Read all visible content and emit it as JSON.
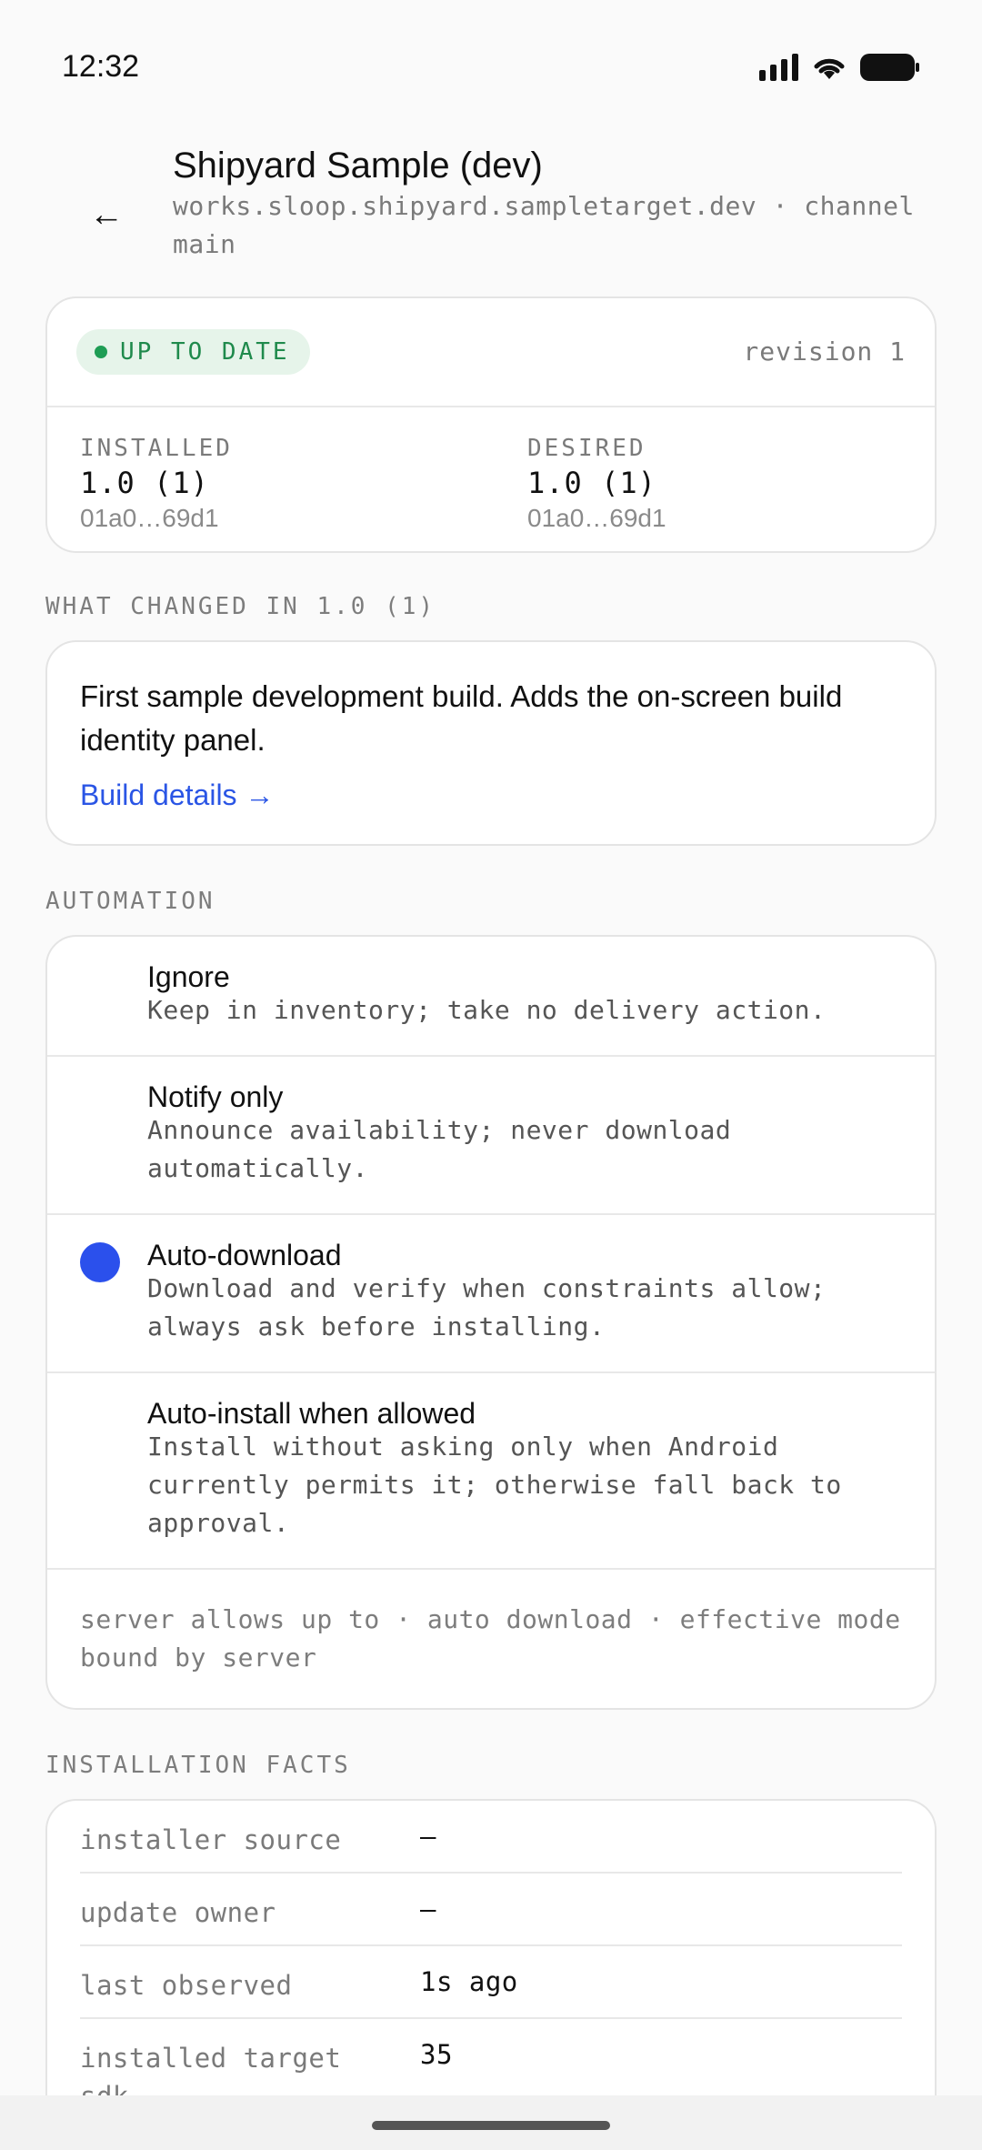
{
  "status_bar": {
    "time": "12:32",
    "icons": [
      "signal-icon",
      "wifi-icon",
      "battery-icon"
    ]
  },
  "header": {
    "back_icon": "←",
    "title": "Shipyard Sample (dev)",
    "subtitle": "works.sloop.shipyard.sampletarget.dev · channel main"
  },
  "status_card": {
    "badge": "UP TO DATE",
    "badge_color": "#1f9d55",
    "revision": "revision 1",
    "installed": {
      "label": "INSTALLED",
      "version": "1.0 (1)",
      "hash": "01a0…69d1"
    },
    "desired": {
      "label": "DESIRED",
      "version": "1.0 (1)",
      "hash": "01a0…69d1"
    }
  },
  "changes": {
    "section_label": "WHAT CHANGED IN 1.0 (1)",
    "text": "First sample development build. Adds the on-screen build identity panel.",
    "link": "Build details →",
    "link_color": "#2a55e5"
  },
  "automation": {
    "section_label": "AUTOMATION",
    "selected": "Auto-download",
    "accent_color": "#2b50ec",
    "options": [
      {
        "title": "Ignore",
        "description": "Keep in inventory; take no delivery action."
      },
      {
        "title": "Notify only",
        "description": "Announce availability; never download automatically."
      },
      {
        "title": "Auto-download",
        "description": "Download and verify when constraints allow; always ask before installing."
      },
      {
        "title": "Auto-install when allowed",
        "description": "Install without asking only when Android currently permits it; otherwise fall back to approval."
      }
    ],
    "footer": "server allows up to · auto download · effective mode bound by server"
  },
  "installation_facts": {
    "section_label": "INSTALLATION FACTS",
    "rows": [
      {
        "key": "installer source",
        "value": "—"
      },
      {
        "key": "update owner",
        "value": "—"
      },
      {
        "key": "last observed",
        "value": "1s ago"
      },
      {
        "key": "installed target sdk",
        "value": "35"
      }
    ]
  }
}
